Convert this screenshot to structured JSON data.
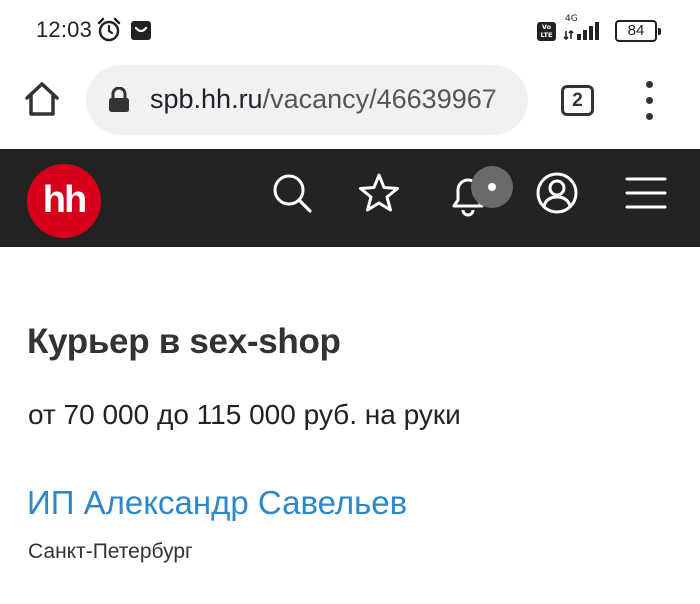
{
  "status_bar": {
    "time": "12:03",
    "network": "4G",
    "volte": "Vo LTE",
    "battery": "84"
  },
  "browser": {
    "url_host": "spb.hh.ru",
    "url_path": "/vacancy/46639967",
    "tab_count": "2"
  },
  "header": {
    "logo": "hh"
  },
  "vacancy": {
    "title": "Курьер в sex-shop",
    "salary": "от 70 000 до 115 000 руб. на руки",
    "company": "ИП Александр Савельев",
    "city": "Санкт-Петербург"
  },
  "colors": {
    "brand_red": "#d6001c",
    "header_bg": "#232323",
    "link_blue": "#2e88c8"
  },
  "icons": {
    "status": [
      "alarm-icon",
      "shopping-bag-icon",
      "signal-icon",
      "battery-icon"
    ],
    "browser": [
      "home-icon",
      "lock-icon",
      "tabs-icon",
      "more-vert-icon"
    ],
    "header": [
      "search-icon",
      "star-icon",
      "bell-icon",
      "profile-icon",
      "hamburger-icon"
    ]
  }
}
